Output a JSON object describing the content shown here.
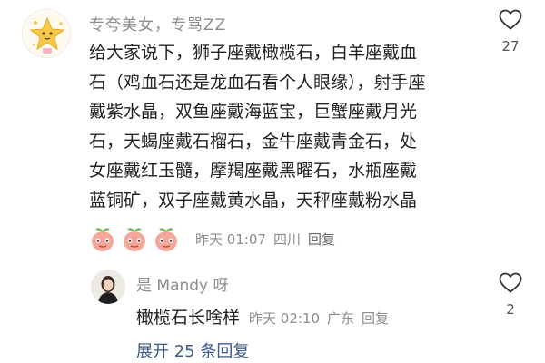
{
  "comment": {
    "username": "专夸美女，专骂ZZ",
    "text_lines": [
      "给大家说下，狮子座戴橄榄石，白羊座戴血",
      "石（鸡血石还是龙血石看个人眼缘），射手座",
      "戴紫水晶，双鱼座戴海蓝宝，巨蟹座戴月光",
      "石，天蝎座戴石榴石，金牛座戴青金石，处",
      "女座戴红玉髓，摩羯座戴黑曜石，水瓶座戴",
      "蓝铜矿，双子座戴黄水晶，天秤座戴粉水晶"
    ],
    "time": "昨天 01:07",
    "location": "四川",
    "reply_label": "回复",
    "likes": "27",
    "sticker_icon": "peach-face-sticker"
  },
  "reply": {
    "username": "是 Mandy 呀",
    "text": "橄榄石长啥样",
    "time": "昨天 02:10",
    "location": "广东",
    "reply_label": "回复",
    "likes": "2"
  },
  "expand_label": "展开 25 条回复",
  "colors": {
    "secondary_text": "#8c8c8c",
    "primary_text": "#222222",
    "link": "#3c5a8a"
  }
}
